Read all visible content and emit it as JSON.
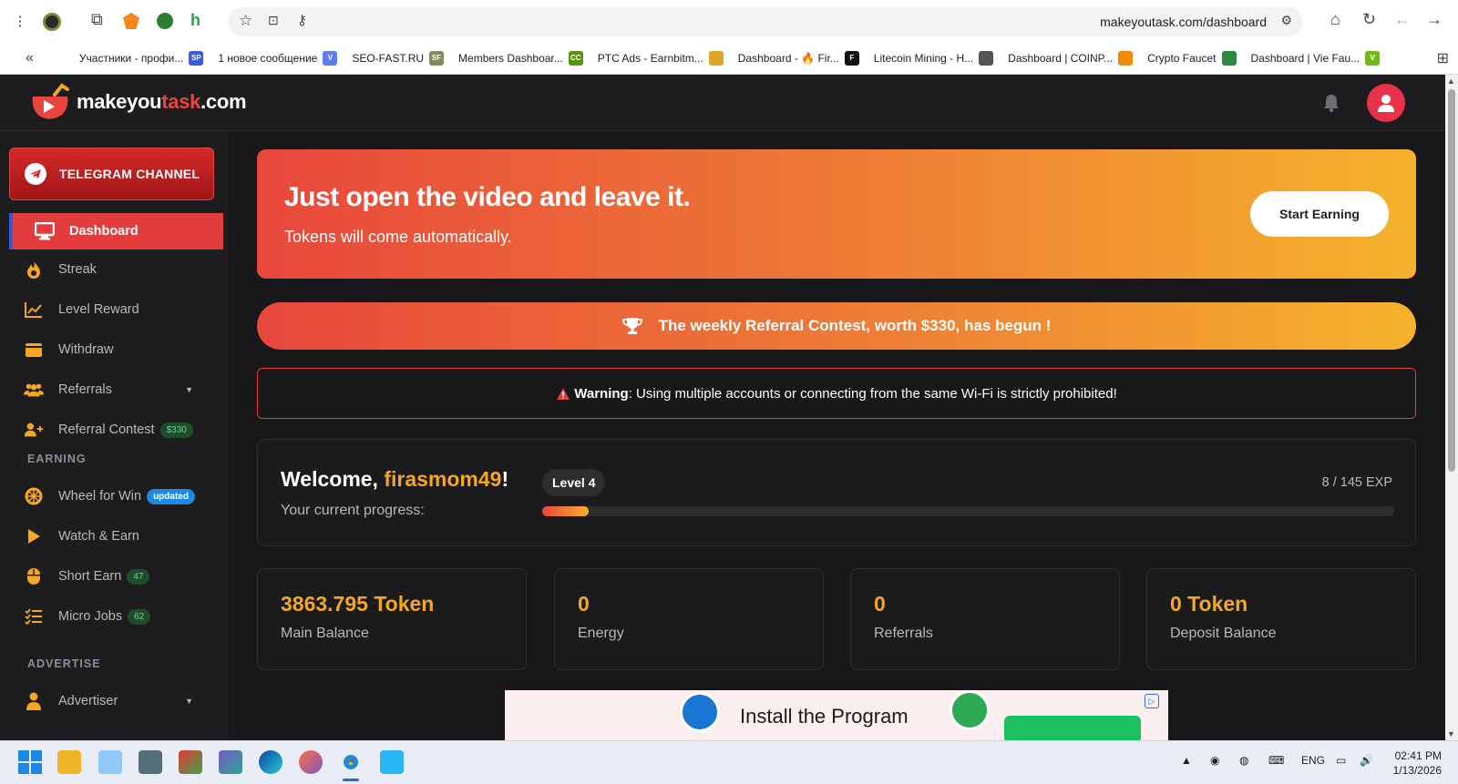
{
  "browser": {
    "url": "makeyoutask.com/dashboard",
    "bookmarks": [
      {
        "label": "Участники - профи...",
        "icon_text": "SP",
        "color": "#3b5bdb"
      },
      {
        "label": "1 новое сообщение",
        "icon_text": "V",
        "color": "#5c7cfa"
      },
      {
        "label": "SEO-FAST.RU",
        "icon_text": "SF",
        "color": "#7c8f5b"
      },
      {
        "label": "Members Dashboar...",
        "icon_text": "CC",
        "color": "#5c940d"
      },
      {
        "label": "PTC Ads - Earnbitm...",
        "icon_text": "",
        "color": "#e0a526"
      },
      {
        "label": "Dashboard - 🔥 Fir...",
        "icon_text": "F",
        "color": "#111111"
      },
      {
        "label": "Litecoin Mining - H...",
        "icon_text": "",
        "color": "#555555"
      },
      {
        "label": "Dashboard | COINP...",
        "icon_text": "",
        "color": "#f08c00"
      },
      {
        "label": "Crypto Faucet",
        "icon_text": "",
        "color": "#2b8a3e"
      },
      {
        "label": "Dashboard | Vie Fau...",
        "icon_text": "V",
        "color": "#74b816"
      }
    ]
  },
  "header": {
    "logo_main": "makeyou",
    "logo_accent": "task",
    "logo_suffix": ".com"
  },
  "sidebar": {
    "telegram_label": "TELEGRAM CHANNEL",
    "items": [
      {
        "label": "Dashboard",
        "icon": "monitor-icon"
      },
      {
        "label": "Streak",
        "icon": "flame-icon"
      },
      {
        "label": "Level Reward",
        "icon": "chart-line-icon"
      },
      {
        "label": "Withdraw",
        "icon": "wallet-icon"
      },
      {
        "label": "Referrals",
        "icon": "users-icon"
      },
      {
        "label": "Referral Contest",
        "icon": "user-plus-icon",
        "badge": "$330"
      }
    ],
    "section_earning": "EARNING",
    "earning_items": [
      {
        "label": "Wheel for Win",
        "icon": "wheel-icon",
        "badge": "updated"
      },
      {
        "label": "Watch & Earn",
        "icon": "play-icon"
      },
      {
        "label": "Short Earn",
        "icon": "mouse-icon",
        "badge": "47"
      },
      {
        "label": "Micro Jobs",
        "icon": "list-check-icon",
        "badge": "62"
      }
    ],
    "section_advertise": "ADVERTISE",
    "advertise_items": [
      {
        "label": "Advertiser",
        "icon": "user-icon"
      }
    ]
  },
  "hero": {
    "title": "Just open the video and leave it.",
    "subtitle": "Tokens will come automatically.",
    "button": "Start Earning"
  },
  "contest_banner": "The weekly Referral Contest, worth $330, has begun !",
  "warning": {
    "label": "Warning",
    "text": ": Using multiple accounts or connecting from the same Wi-Fi is strictly prohibited!"
  },
  "welcome": {
    "greeting": "Welcome, ",
    "username": "firasmom49",
    "suffix": "!",
    "progress_label": "Your current progress:",
    "level": "Level 4",
    "exp": "8 / 145 EXP",
    "progress_fraction": 0.055
  },
  "stats": [
    {
      "value": "3863.795 Token",
      "label": "Main Balance"
    },
    {
      "value": "0",
      "label": "Energy"
    },
    {
      "value": "0",
      "label": "Referrals"
    },
    {
      "value": "0 Token",
      "label": "Deposit Balance"
    }
  ],
  "ad": {
    "text": "Install the Program"
  },
  "taskbar": {
    "lang": "ENG",
    "time": "02:41 PM",
    "date": "1/13/2026"
  }
}
